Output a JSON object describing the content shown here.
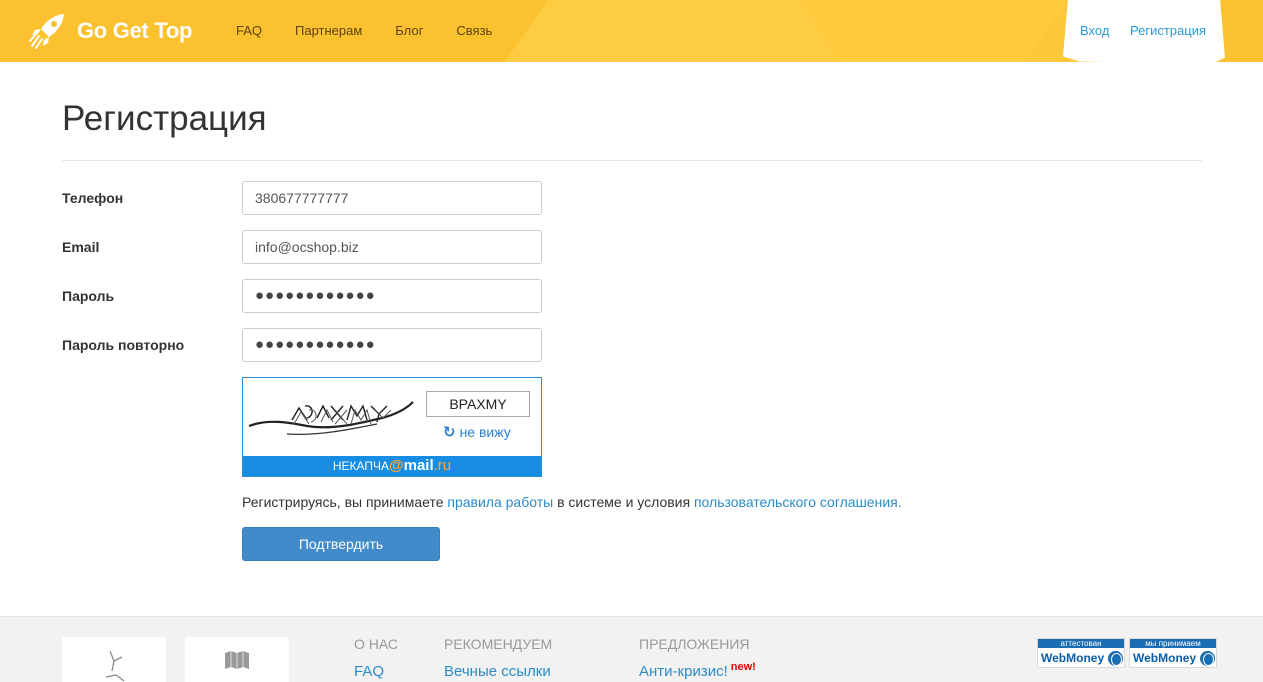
{
  "header": {
    "logo_text": "Go Get Top",
    "nav": [
      "FAQ",
      "Партнерам",
      "Блог",
      "Связь"
    ],
    "login_label": "Вход",
    "register_label": "Регистрация"
  },
  "page": {
    "title": "Регистрация"
  },
  "form": {
    "phone_label": "Телефон",
    "phone_value": "380677777777",
    "email_label": "Email",
    "email_value": "info@ocshop.biz",
    "password_label": "Пароль",
    "password_value": "●●●●●●●●●●●●",
    "password_repeat_label": "Пароль повторно",
    "password_repeat_value": "●●●●●●●●●●●●",
    "captcha": {
      "input_value": "BPAXMY",
      "refresh_label": "не вижу",
      "bar_text_prefix": "НЕКАПЧА",
      "bar_brand_at": "@",
      "bar_brand_name": "mail",
      "bar_brand_suffix": ".ru"
    },
    "agreement_prefix": "Регистрируясь, вы принимаете ",
    "agreement_rules_link": "правила работы",
    "agreement_middle": " в системе и условия ",
    "agreement_terms_link": "пользовательского соглашения.",
    "submit_label": "Подтвердить"
  },
  "footer": {
    "columns": [
      {
        "title": "О НАС",
        "link": "FAQ"
      },
      {
        "title": "РЕКОМЕНДУЕМ",
        "link": "Вечные ссылки"
      },
      {
        "title": "ПРЕДЛОЖЕНИЯ",
        "link": "Анти-кризис!",
        "badge": "new!"
      }
    ],
    "webmoney_badges": [
      {
        "top": "аттестован",
        "bottom": "WebMoney"
      },
      {
        "top": "мы принимаем",
        "bottom": "WebMoney"
      }
    ]
  },
  "colors": {
    "header_bg": "#fbc12e",
    "link": "#2a8bc8",
    "primary_button": "#428bca",
    "captcha_bar": "#168de2"
  }
}
